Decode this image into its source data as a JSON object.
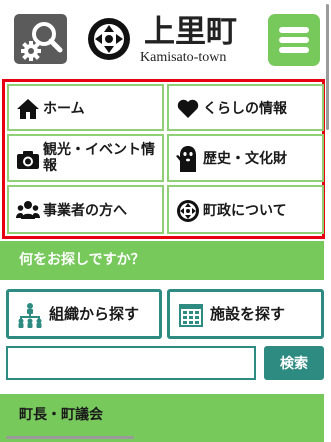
{
  "header": {
    "logo_title": "上里町",
    "logo_subtitle": "Kamisato-town",
    "search_icon": "search-gear-icon",
    "menu_icon": "hamburger-menu-icon"
  },
  "nav": {
    "items": [
      {
        "label": "ホーム",
        "icon": "home-icon"
      },
      {
        "label": "くらしの情報",
        "icon": "heart-icon"
      },
      {
        "label": "観光・イベント情報",
        "icon": "camera-icon"
      },
      {
        "label": "歴史・文化財",
        "icon": "haniwa-icon"
      },
      {
        "label": "事業者の方へ",
        "icon": "people-icon"
      },
      {
        "label": "町政について",
        "icon": "town-emblem-icon"
      }
    ]
  },
  "search": {
    "heading": "何をお探しですか？",
    "by_organization": "組織から探す",
    "by_facility": "施設を探す",
    "input_value": "",
    "input_placeholder": "",
    "submit_label": "検索"
  },
  "section2": {
    "heading": "町長・町議会"
  },
  "colors": {
    "brand_green": "#77c95c",
    "teal": "#2e8b82",
    "highlight_red": "#e60012",
    "search_button_gray": "#5b5b5b"
  }
}
